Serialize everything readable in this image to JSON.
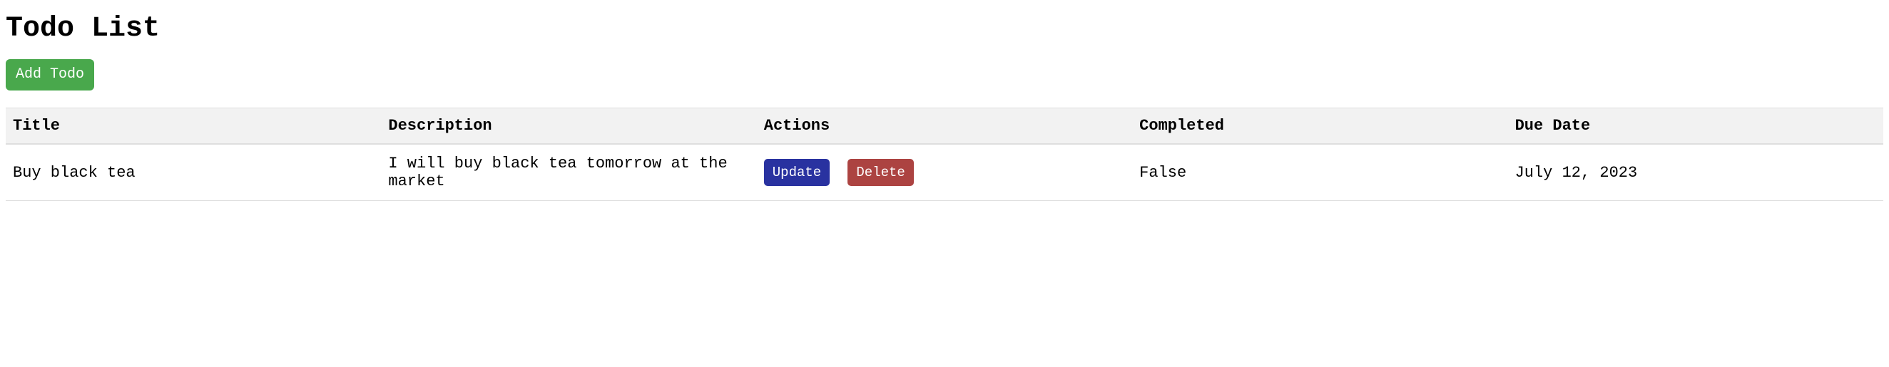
{
  "page": {
    "heading": "Todo List",
    "add_button": "Add Todo"
  },
  "table": {
    "headers": {
      "title": "Title",
      "description": "Description",
      "actions": "Actions",
      "completed": "Completed",
      "due_date": "Due Date"
    },
    "rows": [
      {
        "title": "Buy black tea",
        "description": "I will buy black tea tomorrow at the market",
        "actions": {
          "update": "Update",
          "delete": "Delete"
        },
        "completed": "False",
        "due_date": "July 12, 2023"
      }
    ]
  }
}
